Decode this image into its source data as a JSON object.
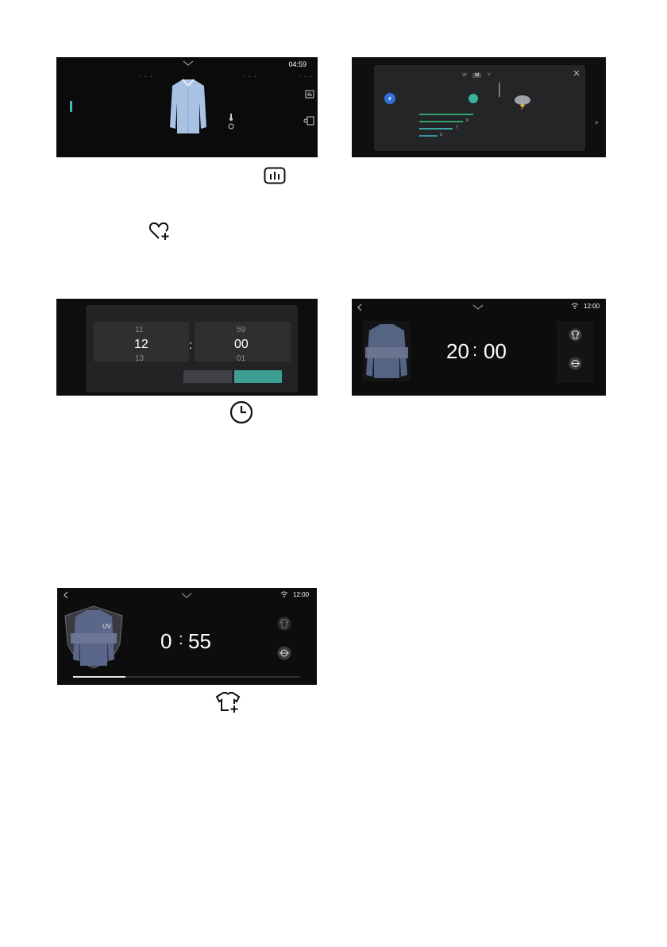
{
  "screen1": {
    "time": "04:59",
    "chevron_icon": "chevron-down-icon",
    "garment": "shirt",
    "icons": [
      "stats-icon",
      "lock-door-icon",
      "thermometer-icon",
      "steam-icon"
    ]
  },
  "screen2": {
    "tabs": [
      "W",
      "M",
      "Y"
    ],
    "active_tab": "M",
    "bar_labels": [
      "9",
      "7",
      "3"
    ],
    "bar_fractions": [
      0.53,
      0.43,
      0.33,
      0.18
    ],
    "accent": "#33a36b",
    "close_icon": "close-icon"
  },
  "stats_icon": "bar-chart-icon",
  "favorite_icon": "heart-plus-icon",
  "screen3": {
    "hour_prev": "11",
    "hour": "12",
    "hour_next": "13",
    "separator": ":",
    "minute_prev": "59",
    "minute": "00",
    "minute_next": "01",
    "accent": "#3d9e93"
  },
  "screen4": {
    "clock": "12:00",
    "timer_hours": "20",
    "timer_sep": ":",
    "timer_minutes": "00"
  },
  "clock_icon": "clock-icon",
  "screen5": {
    "clock": "12:00",
    "badge": "UV",
    "timer_hours": "0",
    "timer_sep": ":",
    "timer_minutes": "55",
    "progress": 0.23
  },
  "shirt_plus_icon": "shirt-plus-icon"
}
